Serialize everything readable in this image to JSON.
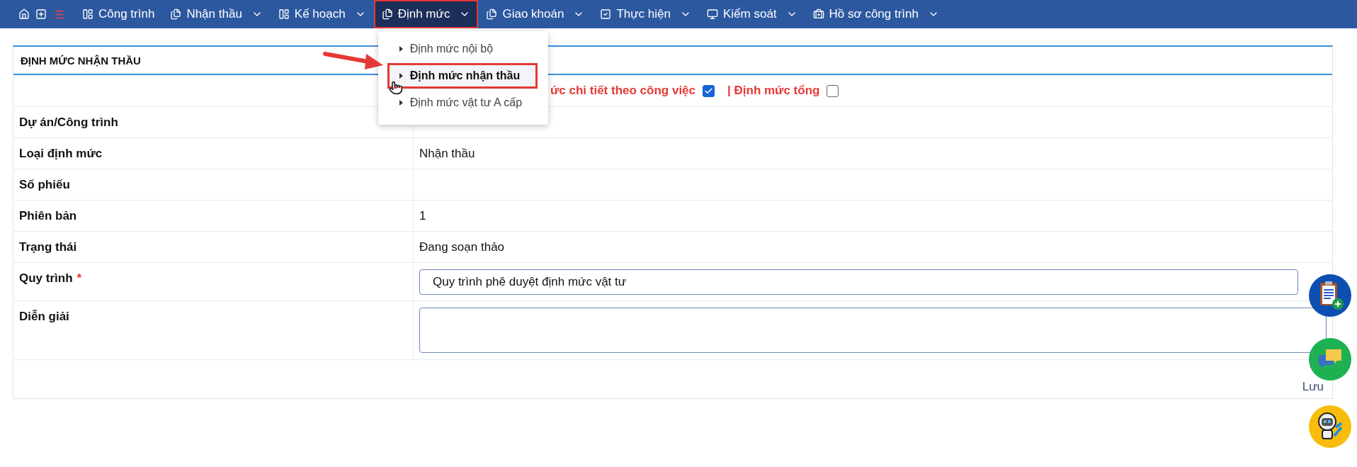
{
  "nav": {
    "items": [
      {
        "label": "Công trình",
        "dropdown": false,
        "selected": false,
        "highlighted": false
      },
      {
        "label": "Nhận thầu",
        "dropdown": true,
        "selected": false,
        "highlighted": false
      },
      {
        "label": "Kế hoạch",
        "dropdown": true,
        "selected": false,
        "highlighted": false
      },
      {
        "label": "Định mức",
        "dropdown": true,
        "selected": true,
        "highlighted": true,
        "menu": [
          {
            "label": "Định mức nội bộ",
            "selected": false,
            "highlighted": false
          },
          {
            "label": "Định mức nhận thầu",
            "selected": true,
            "highlighted": true
          },
          {
            "label": "Định mức vật tư A cấp",
            "selected": false,
            "highlighted": false
          }
        ]
      },
      {
        "label": "Giao khoán",
        "dropdown": true,
        "selected": false,
        "highlighted": false
      },
      {
        "label": "Thực hiện",
        "dropdown": true,
        "selected": false,
        "highlighted": false
      },
      {
        "label": "Kiểm soát",
        "dropdown": true,
        "selected": false,
        "highlighted": false
      },
      {
        "label": "Hồ sơ công trình",
        "dropdown": true,
        "selected": false,
        "highlighted": false
      }
    ]
  },
  "card": {
    "title": "ĐỊNH MỨC NHẬN THẦU",
    "options": [
      {
        "label": "ức chi tiết theo công việc",
        "checked": true
      },
      {
        "label": "| Định mức tổng",
        "checked": false
      }
    ],
    "rows": [
      {
        "kind": "text",
        "label": "Dự án/Công trình"
      },
      {
        "kind": "text",
        "label": "Loại định mức",
        "value": "Nhận thầu"
      },
      {
        "kind": "text",
        "label": "Số phiếu"
      },
      {
        "kind": "text",
        "label": "Phiên bản",
        "value": "1"
      },
      {
        "kind": "text",
        "label": "Trạng thái",
        "value": "Đang soạn thảo"
      },
      {
        "kind": "select",
        "label": "Quy trình",
        "required_mark": "*",
        "value": "Quy trình phê duyệt định mức vật tư"
      },
      {
        "kind": "textarea",
        "label": "Diễn giải"
      }
    ],
    "save_button": "Lưu"
  }
}
